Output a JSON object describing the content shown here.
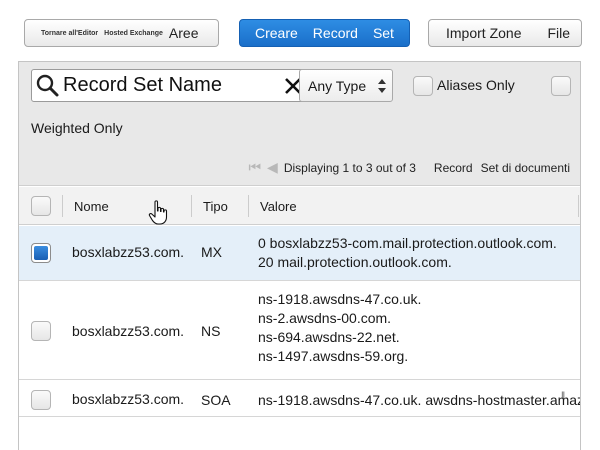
{
  "toolbar": {
    "back_small": "Tornare all'Editor",
    "back_small2": "Hosted Exchange",
    "back_label": "Aree",
    "create_words": [
      "Creare",
      "Record",
      "Set"
    ],
    "import_label": "Import Zone",
    "file_label": "File"
  },
  "filters": {
    "search_value": "Record Set Name",
    "type_select": "Any Type",
    "aliases_label": "Aliases Only",
    "weighted_label": "Weighted Only"
  },
  "pager": {
    "text": "Displaying 1 to 3 out of 3",
    "record_label": "Record",
    "set_label": "Set di documenti"
  },
  "columns": {
    "name": "Nome",
    "type": "Tipo",
    "value": "Valore"
  },
  "rows": [
    {
      "name": "bosxlabzz53.com.",
      "type": "MX",
      "values": [
        "0 bosxlabzz53-com.mail.protection.outlook.com.",
        "20 mail.protection.outlook.com."
      ],
      "selected": true
    },
    {
      "name": "bosxlabzz53.com.",
      "type": "NS",
      "values": [
        "ns-1918.awsdns-47.co.uk.",
        "ns-2.awsdns-00.com.",
        "ns-694.awsdns-22.net.",
        "ns-1497.awsdns-59.org."
      ],
      "selected": false
    },
    {
      "name": "bosxlabzz53.com.",
      "type": "SOA",
      "values": [
        "ns-1918.awsdns-47.co.uk. awsdns-hostmaster.amaz"
      ],
      "selected": false
    }
  ],
  "colors": {
    "accent": "#1a6fc9",
    "selected_row": "#e4eff9",
    "filter_bg": "#e8e8e8"
  },
  "icons": [
    "search-icon",
    "clear-icon",
    "select-arrows-icon",
    "first-page-icon",
    "prev-page-icon",
    "next-page-icon",
    "last-page-icon",
    "hand-cursor-icon"
  ]
}
